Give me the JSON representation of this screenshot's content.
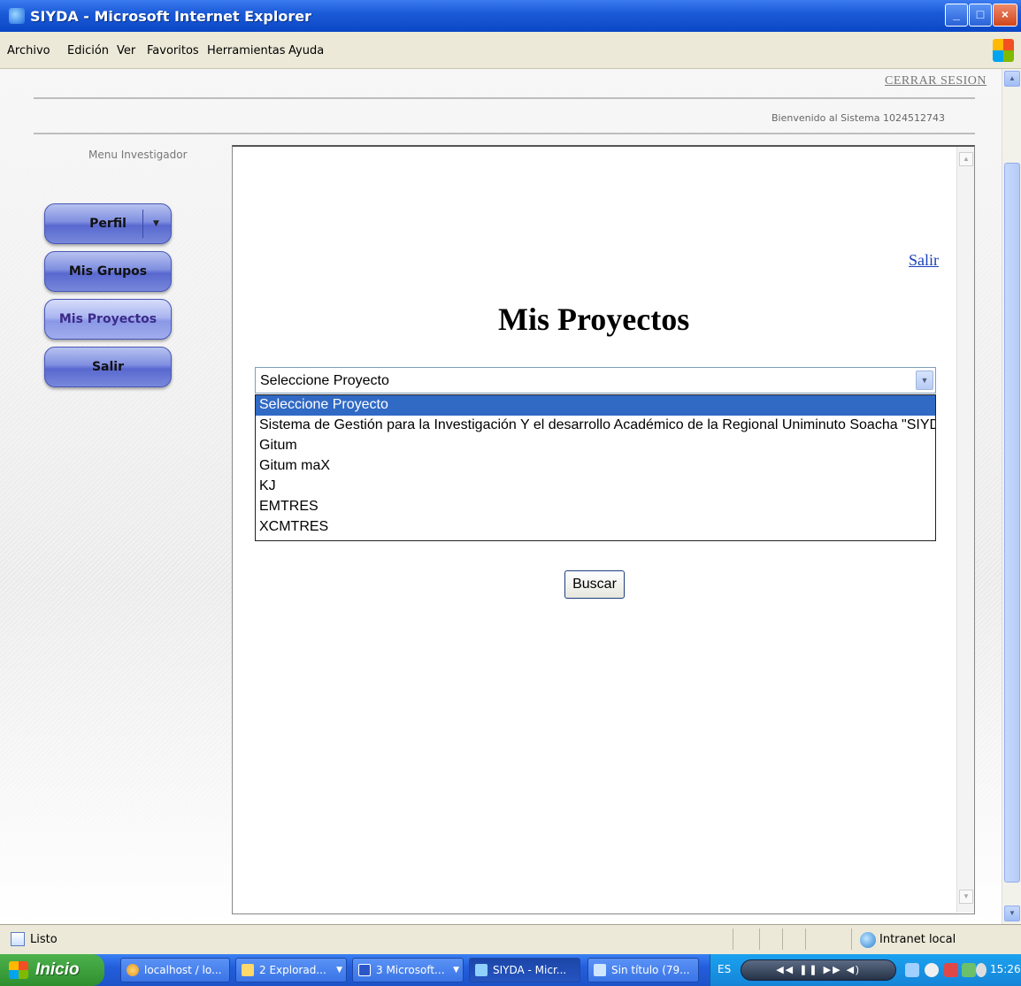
{
  "window": {
    "title": "SIYDA - Microsoft Internet Explorer",
    "min": "_",
    "max": "□",
    "close": "×"
  },
  "menubar": [
    "Archivo",
    "Edición",
    "Ver",
    "Favoritos",
    "Herramientas",
    "Ayuda"
  ],
  "header": {
    "logout": "CERRAR SESION",
    "welcome": "Bienvenido al Sistema 1024512743"
  },
  "sidebar": {
    "title": "Menu Investigador",
    "items": [
      {
        "label": "Perfil",
        "icon": "caret-down-icon"
      },
      {
        "label": "Mis Grupos"
      },
      {
        "label": "Mis Proyectos",
        "active": true
      },
      {
        "label": "Salir"
      }
    ]
  },
  "content": {
    "exit_link": "Salir",
    "title": "Mis Proyectos",
    "select": {
      "value": "Seleccione Proyecto",
      "options": [
        "Seleccione Proyecto",
        "Sistema de Gestión para la Investigación Y el desarrollo Académico de la Regional Uniminuto Soacha \"SIYDA\"",
        "Gitum",
        "Gitum maX",
        "KJ",
        "EMTRES",
        "XCMTRES"
      ],
      "highlighted_index": 0
    },
    "search_button": "Buscar"
  },
  "statusbar": {
    "status": "Listo",
    "zone": "Intranet local"
  },
  "taskbar": {
    "start": "Inicio",
    "tasks": [
      "localhost / lo...",
      "2 Explorad...",
      "3 Microsoft...",
      "SIYDA - Micr...",
      "Sin título (79..."
    ],
    "lang": "ES",
    "clock": "15:26"
  },
  "colors": {
    "accent": "#316ac5",
    "title_bar": "#0a47c6",
    "button_blue": "#7f8ee0"
  }
}
